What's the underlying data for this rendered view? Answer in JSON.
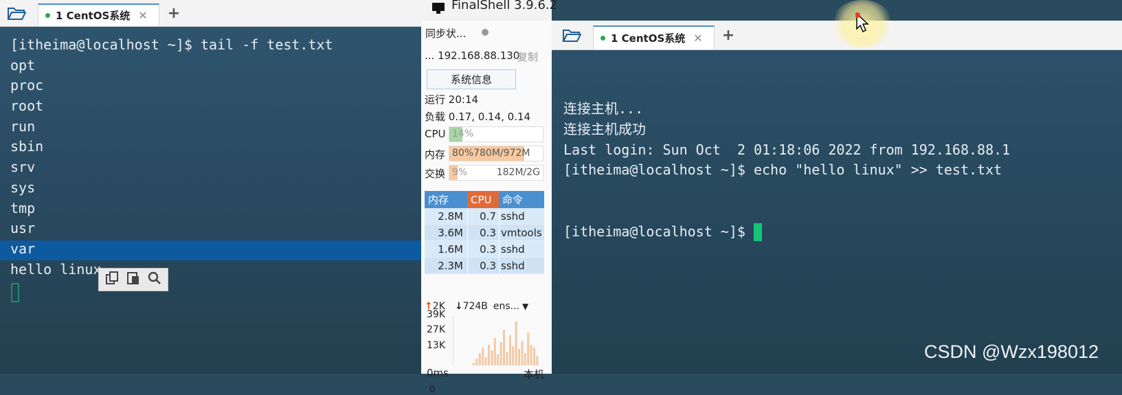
{
  "left_window": {
    "tab_label": "1 CentOS系统",
    "terminal_lines": [
      "[itheima@localhost ~]$ tail -f test.txt",
      "opt",
      "proc",
      "root",
      "run",
      "sbin",
      "srv",
      "sys",
      "tmp",
      "usr",
      "var",
      "hello linux"
    ],
    "selected_line": "var"
  },
  "app": {
    "title": "FinalShell 3.9.6.2"
  },
  "sidebar": {
    "sync_status": "同步状...",
    "host": "... 192.168.88.130",
    "copy_label": "复制",
    "sysinfo_button": "系统信息",
    "uptime_label": "运行",
    "uptime_value": "20:14",
    "load_label": "负载",
    "load_value": "0.17, 0.14, 0.14",
    "cpu_label": "CPU",
    "cpu_value": "14%",
    "cpu_fraction": 0.14,
    "mem_label": "内存",
    "mem_value": "80%780M/972M",
    "mem_fraction": 0.8,
    "swap_label": "交换",
    "swap_percent": "9%",
    "swap_value": "182M/2G",
    "swap_fraction": 0.09,
    "proc_headers": {
      "mem": "内存",
      "cpu": "CPU",
      "cmd": "命令"
    },
    "processes": [
      {
        "mem": "2.8M",
        "cpu": "0.7",
        "cmd": "sshd"
      },
      {
        "mem": "3.6M",
        "cpu": "0.3",
        "cmd": "vmtools"
      },
      {
        "mem": "1.6M",
        "cpu": "0.3",
        "cmd": "sshd"
      },
      {
        "mem": "2.3M",
        "cpu": "0.3",
        "cmd": "sshd"
      }
    ],
    "net_up": "2K",
    "net_down": "724B",
    "net_iface": "ens...",
    "graph_labels": [
      "39K",
      "27K",
      "13K"
    ],
    "latency": "0ms",
    "local_label": "本机",
    "latency_zero": "0"
  },
  "right_window": {
    "tab_label": "1 CentOS系统",
    "terminal_lines": [
      "连接主机...",
      "连接主机成功",
      "Last login: Sun Oct  2 01:18:06 2022 from 192.168.88.1",
      "[itheima@localhost ~]$ echo \"hello linux\" >> test.txt"
    ],
    "prompt": "[itheima@localhost ~]$ "
  },
  "watermark": "CSDN @Wzx198012"
}
